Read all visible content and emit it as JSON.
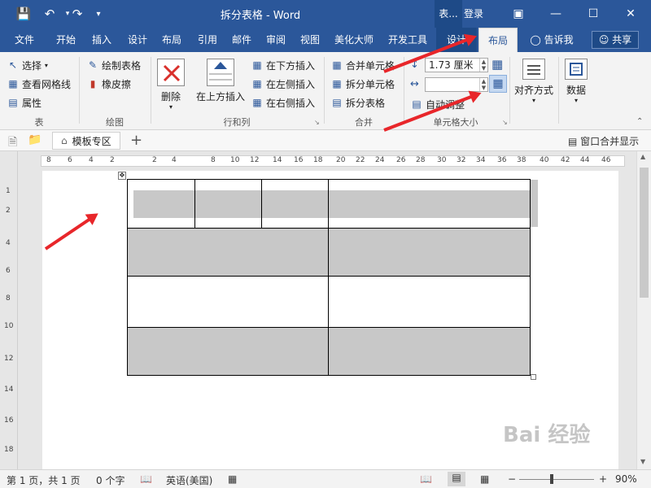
{
  "titlebar": {
    "title": "拆分表格  -  Word",
    "context_tab": "表...",
    "login": "登录"
  },
  "tabs": [
    {
      "label": "文件"
    },
    {
      "label": "开始"
    },
    {
      "label": "插入"
    },
    {
      "label": "设计"
    },
    {
      "label": "布局"
    },
    {
      "label": "引用"
    },
    {
      "label": "邮件"
    },
    {
      "label": "审阅"
    },
    {
      "label": "视图"
    },
    {
      "label": "美化大师"
    },
    {
      "label": "开发工具"
    },
    {
      "label": "设计"
    },
    {
      "label": "布局"
    }
  ],
  "tell_me": "告诉我",
  "share": "共享",
  "ribbon": {
    "table_group": {
      "label": "表",
      "select": "选择",
      "gridlines": "查看网格线",
      "properties": "属性"
    },
    "draw_group": {
      "label": "绘图",
      "draw_table": "绘制表格",
      "eraser": "橡皮擦"
    },
    "rows_cols_group": {
      "label": "行和列",
      "delete": "删除",
      "insert_above": "在上方插入",
      "insert_below": "在下方插入",
      "insert_left": "在左侧插入",
      "insert_right": "在右侧插入"
    },
    "merge_group": {
      "label": "合并",
      "merge_cells": "合并单元格",
      "split_cells": "拆分单元格",
      "split_table": "拆分表格"
    },
    "cell_size_group": {
      "label": "单元格大小",
      "height_value": "1.73 厘米",
      "width_value": "",
      "autofit": "自动调整"
    },
    "alignment": "对齐方式",
    "data": "数据"
  },
  "doc_tab": {
    "label": "模板专区",
    "merge_view": "窗口合并显示"
  },
  "ruler": [
    "8",
    "6",
    "4",
    "2",
    "2",
    "4",
    "8",
    "10",
    "12",
    "14",
    "16",
    "18",
    "20",
    "22",
    "24",
    "26",
    "28",
    "30",
    "32",
    "34",
    "36",
    "38",
    "40",
    "42",
    "44",
    "46"
  ],
  "vruler": [
    "1",
    "2",
    "4",
    "6",
    "8",
    "10",
    "12",
    "14",
    "16",
    "18"
  ],
  "status": {
    "page": "第 1 页，共 1 页",
    "words": "0 个字",
    "language": "英语(美国)",
    "zoom": "90%"
  },
  "watermark": "Bai 经验",
  "colors": {
    "brand": "#2b579a",
    "arrow": "#e8262a",
    "shade": "#c8c8c8"
  }
}
